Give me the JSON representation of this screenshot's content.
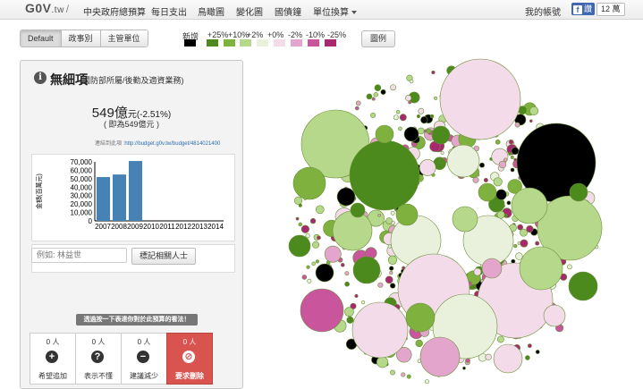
{
  "header": {
    "brand": "G0V",
    "brand_tld": ".tw",
    "brand_sep": "/",
    "site_name": "中央政府總預算",
    "nav": [
      "每日支出",
      "鳥瞰圖",
      "變化圖",
      "國債鐘",
      "單位換算"
    ],
    "user_link": "我的帳號",
    "like_label": "讚",
    "like_count": "12 萬"
  },
  "toolbar": {
    "views": [
      "Default",
      "政事別",
      "主管單位"
    ],
    "active_view": "Default",
    "legend_button": "圖例"
  },
  "legend": {
    "labels": [
      "新增",
      "+25%",
      "+10%",
      "+2%",
      "+0%",
      "-2%",
      "-10%",
      "-25%"
    ],
    "colors": [
      "#000000",
      "#4d8a1d",
      "#7fb13f",
      "#b6d88a",
      "#e9f1dc",
      "#f4dbea",
      "#e3a5cc",
      "#c9559d",
      "#a8286f"
    ]
  },
  "detail": {
    "title": "無細項",
    "subtitle": "(國防部所屬/後勤及適資業務)",
    "amount_value": "549億",
    "amount_unit": "元",
    "amount_change": "(-2.51%)",
    "amount_note": "( 即為549億元 )",
    "permalink_label": "連結到此項 :",
    "permalink_url": "http://budget.g0v.tw/budget/4814021400",
    "tag_placeholder": "例如: 林益世",
    "tag_button": "標記相關人士",
    "feedback_banner": "透過按一下表達你對於此預算的看法！",
    "votes": [
      {
        "count": "0 人",
        "label": "希望追加",
        "icon": "plus-icon"
      },
      {
        "count": "0 人",
        "label": "表示不懂",
        "icon": "question-icon"
      },
      {
        "count": "0 人",
        "label": "建議減少",
        "icon": "minus-icon"
      },
      {
        "count": "0 人",
        "label": "要求刪除",
        "icon": "ban-icon"
      }
    ]
  },
  "chart_data": {
    "type": "bar",
    "ylabel": "金額(百萬元)",
    "categories": [
      "2007",
      "2008",
      "2009",
      "2010",
      "2011",
      "2012",
      "2013",
      "2014"
    ],
    "values": [
      52000,
      55000,
      71000,
      0,
      0,
      0,
      0,
      0
    ],
    "yticks": [
      "0",
      "10,000",
      "20,000",
      "30,000",
      "40,000",
      "50,000",
      "60,000",
      "70,000"
    ],
    "ylim": [
      0,
      70000
    ],
    "bar_color": "#4682b4"
  }
}
